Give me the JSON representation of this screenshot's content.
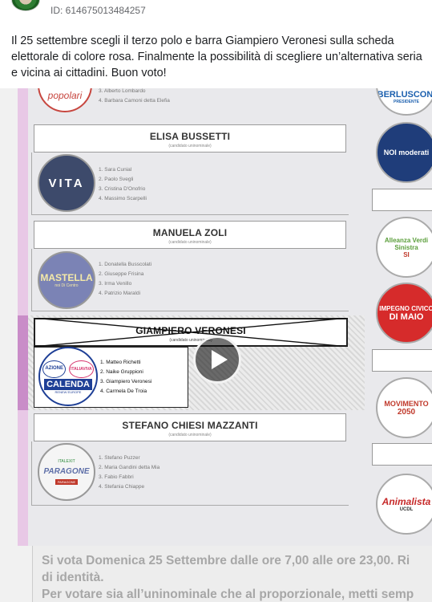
{
  "post": {
    "id_label": "ID: 614675013484257",
    "text": "Il 25 settembre scegli il terzo polo e barra Giampiero Veronesi sulla scheda elettorale di colore rosa. Finalmente la possibilità di scegliere un’alternativa seria e vicina ai cittadini. Buon voto!"
  },
  "ballot": {
    "top_list": [
      "Alberto Lombardo",
      "Barbara Camoni detta Elefia"
    ],
    "top_symbol": "popolari",
    "candidates": [
      {
        "name": "ELISA BUSSETTI",
        "sub": "(candidato uninominale)",
        "symbol": "VITA",
        "list": [
          "Sara Cunial",
          "Paolo Svegli",
          "Cristina D'Onofrio",
          "Massimo Scarpelli"
        ]
      },
      {
        "name": "MANUELA ZOLI",
        "sub": "(candidato uninominale)",
        "symbol": "MASTELLA",
        "symbol_sub": "noi Di Centro",
        "list": [
          "Donatella Busscolati",
          "Giuseppe Frisina",
          "Irma Venillo",
          "Patrizio Maraldi"
        ]
      },
      {
        "name": "GIAMPIERO VERONESI",
        "sub": "(candidato uninominale)",
        "symbol_top_left": "AZIONE",
        "symbol_top_right": "ITALIAVIVA",
        "symbol": "CALENDA",
        "symbol_sub": "RENEW EUROPE",
        "list": [
          "Matteo Richetti",
          "Naike Gruppioni",
          "Giampiero Veronesi",
          "Carmela De Troia"
        ]
      },
      {
        "name": "STEFANO CHIESI MAZZANTI",
        "sub": "(candidato uninominale)",
        "symbol_top": "ITALEXIT",
        "symbol": "PARAGONE",
        "symbol_sub": "PARAGONE",
        "list": [
          "Stefano Puzzer",
          "Maria Gandini detta Mia",
          "Fabio Fabbri",
          "Stefania Chiappe"
        ]
      }
    ],
    "right_symbols": [
      {
        "label": "BERLUSCONI",
        "sub": "PRESIDENTE"
      },
      {
        "label": "NOI moderati",
        "sub": ""
      },
      {
        "label": "Alleanza Verdi Sinistra",
        "sub": "SI"
      },
      {
        "label": "IMPEGNO CIVICO",
        "sub": "DI MAIO"
      },
      {
        "label": "MOVIMENTO",
        "sub": "2050"
      },
      {
        "label": "Animalista",
        "sub": "UCDL"
      }
    ],
    "info_line1": "Si vota Domenica 25 Settembre dalle ore 7,00 alle ore 23,00. Ri",
    "info_line2": "di identità.",
    "info_line3": "Per votare sia all’uninominale che al proporzionale, metti semp"
  },
  "colors": {
    "pink": "#e8c8e6",
    "pink_active": "#c98dc8",
    "calenda_blue": "#1e3f96",
    "berlusconi_blue": "#1b5fae",
    "impegno_red": "#d62b2b",
    "movimento_red": "#c0392b",
    "animalista_red": "#c62828",
    "avs_green": "#5a9e3a"
  },
  "video": {
    "play_icon": "play-icon"
  }
}
